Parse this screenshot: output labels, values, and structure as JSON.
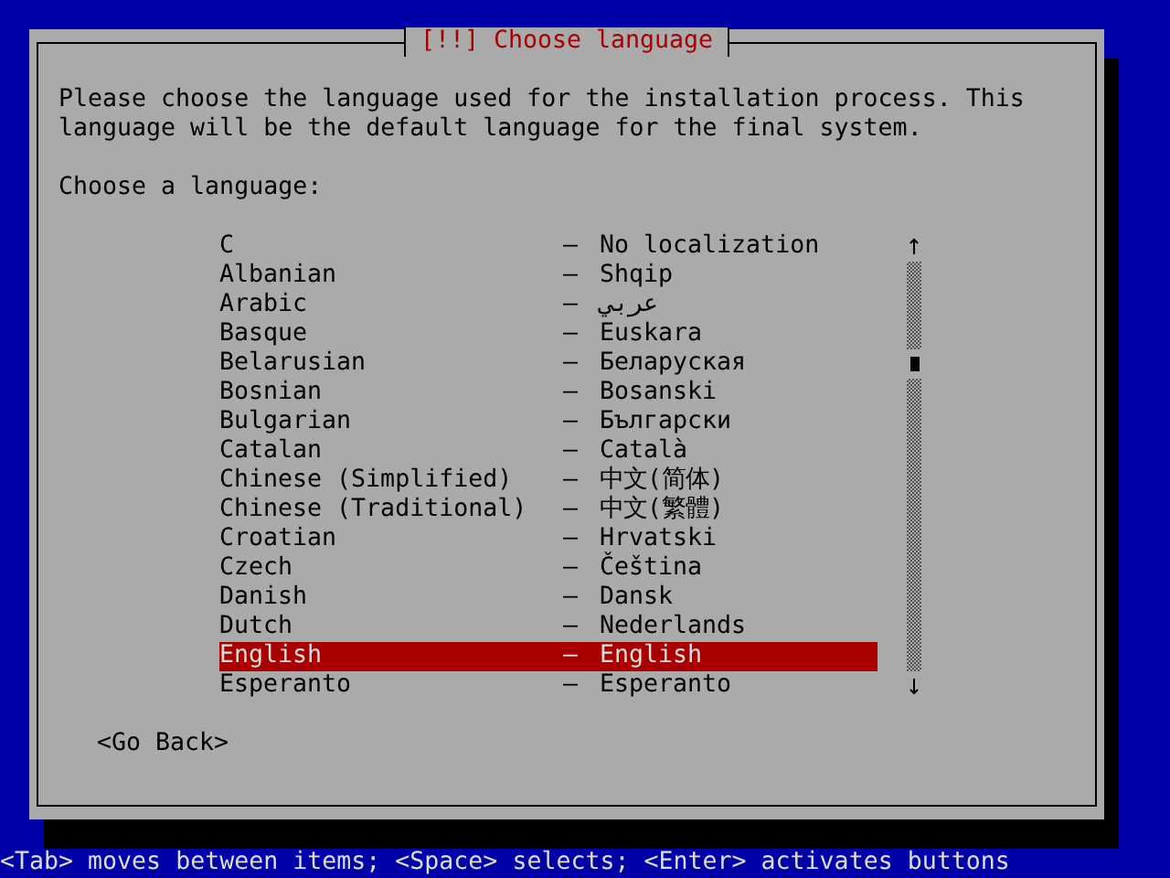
{
  "dialog": {
    "title": "[!!] Choose language",
    "description": "Please choose the language used for the installation process. This language will be the default language for the final system.",
    "prompt": "Choose a language:",
    "languages": [
      {
        "name": "C",
        "separator": "–",
        "native": "No localization",
        "selected": false
      },
      {
        "name": "Albanian",
        "separator": "–",
        "native": "Shqip",
        "selected": false
      },
      {
        "name": "Arabic",
        "separator": "–",
        "native": "عربي",
        "selected": false
      },
      {
        "name": "Basque",
        "separator": "–",
        "native": "Euskara",
        "selected": false
      },
      {
        "name": "Belarusian",
        "separator": "–",
        "native": "Беларуская",
        "selected": false
      },
      {
        "name": "Bosnian",
        "separator": "–",
        "native": "Bosanski",
        "selected": false
      },
      {
        "name": "Bulgarian",
        "separator": "–",
        "native": "Български",
        "selected": false
      },
      {
        "name": "Catalan",
        "separator": "–",
        "native": "Català",
        "selected": false
      },
      {
        "name": "Chinese (Simplified)",
        "separator": "–",
        "native": "中文(简体)",
        "selected": false
      },
      {
        "name": "Chinese (Traditional)",
        "separator": "–",
        "native": "中文(繁體)",
        "selected": false
      },
      {
        "name": "Croatian",
        "separator": "–",
        "native": "Hrvatski",
        "selected": false
      },
      {
        "name": "Czech",
        "separator": "–",
        "native": "Čeština",
        "selected": false
      },
      {
        "name": "Danish",
        "separator": "–",
        "native": "Dansk",
        "selected": false
      },
      {
        "name": "Dutch",
        "separator": "–",
        "native": "Nederlands",
        "selected": false
      },
      {
        "name": "English",
        "separator": "–",
        "native": "English",
        "selected": true
      },
      {
        "name": "Esperanto",
        "separator": "–",
        "native": "Esperanto",
        "selected": false
      }
    ],
    "buttons": [
      "<Go Back>"
    ]
  },
  "status_bar": "<Tab> moves between items; <Space> selects; <Enter> activates buttons"
}
